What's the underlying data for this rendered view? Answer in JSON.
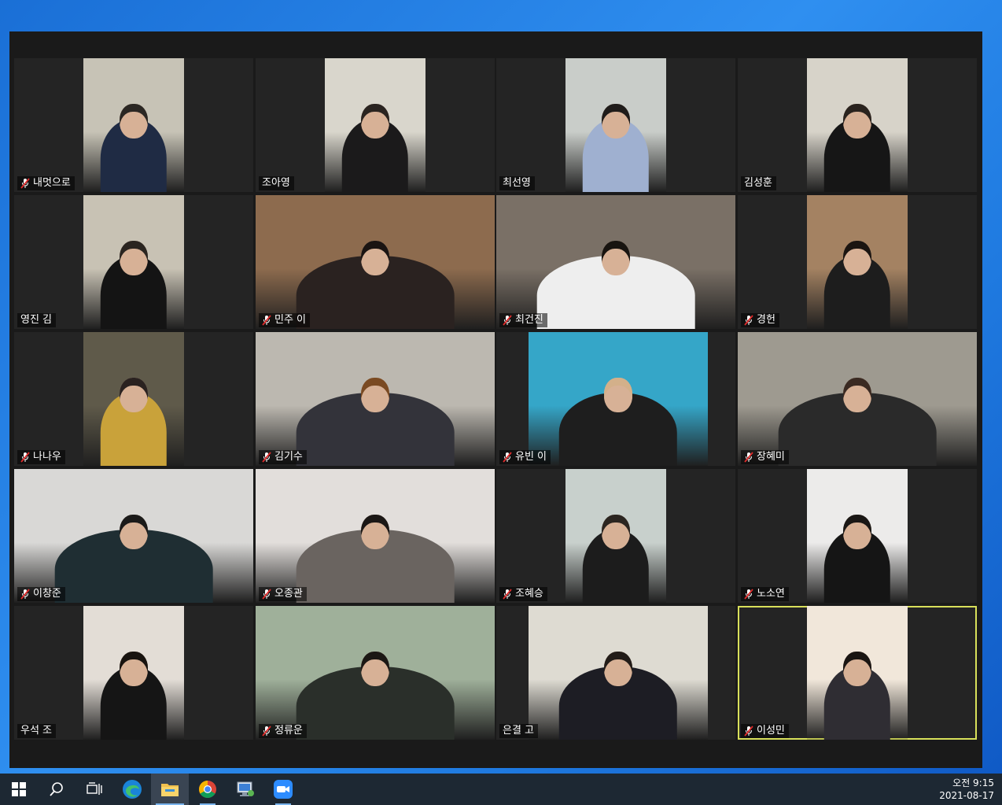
{
  "meeting": {
    "participants": [
      {
        "name": "내멋으로",
        "muted": true
      },
      {
        "name": "조아영",
        "muted": false
      },
      {
        "name": "최선영",
        "muted": false
      },
      {
        "name": "김성훈",
        "muted": false
      },
      {
        "name": "영진 김",
        "muted": false
      },
      {
        "name": "민주 이",
        "muted": true
      },
      {
        "name": "최건진",
        "muted": true
      },
      {
        "name": "경헌",
        "muted": true
      },
      {
        "name": "나나우",
        "muted": true
      },
      {
        "name": "김기수",
        "muted": true
      },
      {
        "name": "유빈 이",
        "muted": true
      },
      {
        "name": "장혜미",
        "muted": true
      },
      {
        "name": "이창준",
        "muted": true
      },
      {
        "name": "오종관",
        "muted": true
      },
      {
        "name": "조혜승",
        "muted": true
      },
      {
        "name": "노소연",
        "muted": true
      },
      {
        "name": "우석 조",
        "muted": false
      },
      {
        "name": "정류운",
        "muted": true
      },
      {
        "name": "은결 고",
        "muted": false
      },
      {
        "name": "이성민",
        "muted": true,
        "active_speaker": true
      }
    ]
  },
  "taskbar": {
    "apps": [
      {
        "name": "start-button",
        "icon": "windows-logo-icon"
      },
      {
        "name": "search-button",
        "icon": "search-icon"
      },
      {
        "name": "task-view-button",
        "icon": "task-view-icon"
      },
      {
        "name": "edge-button",
        "icon": "edge-icon"
      },
      {
        "name": "file-explorer-button",
        "icon": "folder-icon"
      },
      {
        "name": "chrome-button",
        "icon": "chrome-icon"
      },
      {
        "name": "remote-desktop-button",
        "icon": "remote-desktop-icon"
      },
      {
        "name": "zoom-button",
        "icon": "zoom-icon"
      }
    ],
    "clock": {
      "time": "오전 9:15",
      "date": "2021-08-17"
    }
  },
  "colors": {
    "desktop": "#1f7ae0",
    "window_bg": "#1a1a1a",
    "tile_bg": "#242424",
    "active_speaker_border": "#d8e05a",
    "taskbar_bg": "#1d2833",
    "mute_red": "#e02c2c"
  }
}
